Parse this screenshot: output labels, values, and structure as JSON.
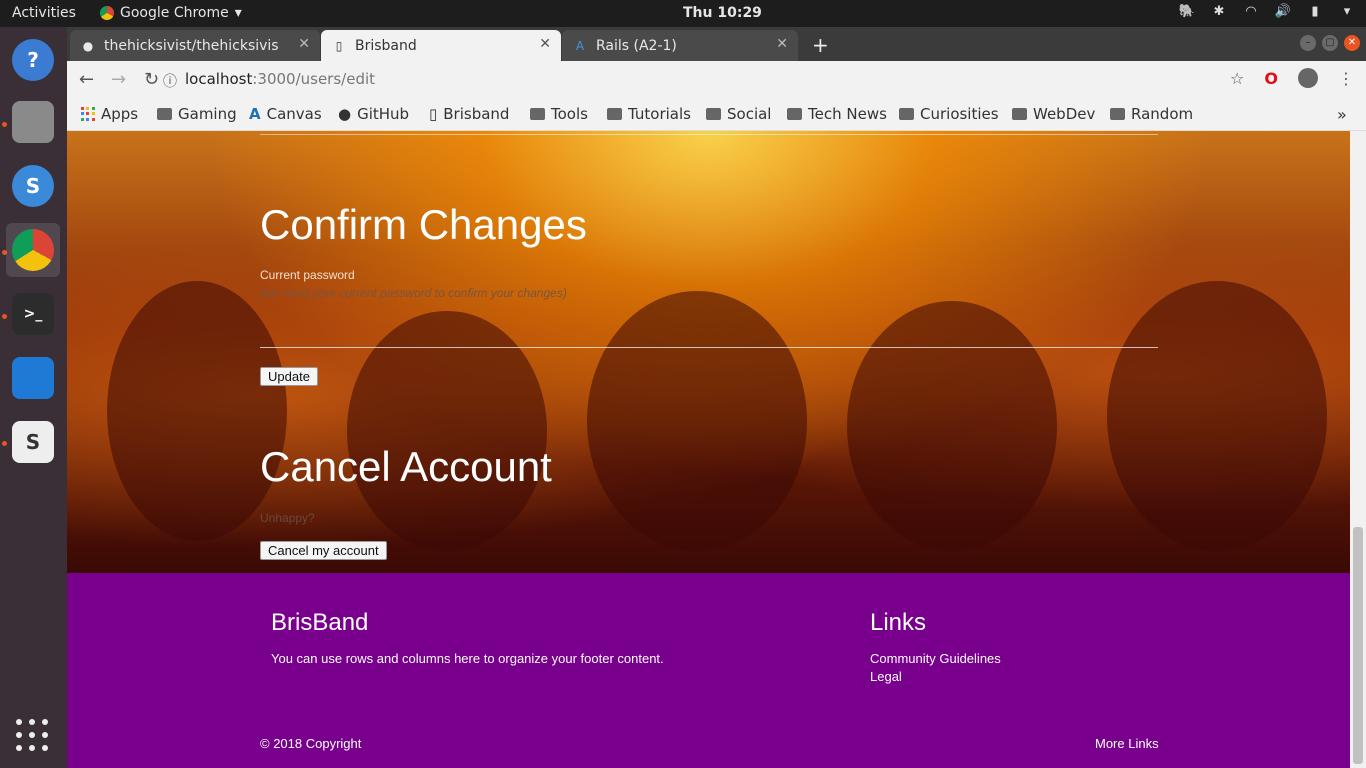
{
  "topbar": {
    "activities": "Activities",
    "app_name": "Google Chrome",
    "clock": "Thu 10:29"
  },
  "tabs": [
    {
      "label": "thehicksivist/thehicksivis",
      "icon": "github-icon"
    },
    {
      "label": "Brisband",
      "icon": "page-icon"
    },
    {
      "label": "Rails (A2-1)",
      "icon": "canvas-icon"
    }
  ],
  "omnibar": {
    "url_host": "localhost",
    "url_rest": ":3000/users/edit"
  },
  "bookmarks": [
    {
      "label": "Apps",
      "icon": "apps-icon"
    },
    {
      "label": "Gaming",
      "icon": "folder-icon"
    },
    {
      "label": "Canvas",
      "icon": "canvas-icon"
    },
    {
      "label": "GitHub",
      "icon": "github-icon"
    },
    {
      "label": "Brisband",
      "icon": "page-icon"
    },
    {
      "label": "Tools",
      "icon": "folder-icon"
    },
    {
      "label": "Tutorials",
      "icon": "folder-icon"
    },
    {
      "label": "Social",
      "icon": "folder-icon"
    },
    {
      "label": "Tech News",
      "icon": "folder-icon"
    },
    {
      "label": "Curiosities",
      "icon": "folder-icon"
    },
    {
      "label": "WebDev",
      "icon": "folder-icon"
    },
    {
      "label": "Random",
      "icon": "folder-icon"
    }
  ],
  "confirm": {
    "title": "Confirm Changes",
    "password_label": "Current password",
    "password_hint": "(we need your current password to confirm your changes)",
    "update_button": "Update"
  },
  "cancel": {
    "title": "Cancel Account",
    "text": "Unhappy?",
    "button": "Cancel my account"
  },
  "footer": {
    "brand_title": "BrisBand",
    "brand_text": "You can use rows and columns here to organize your footer content.",
    "links_title": "Links",
    "links": [
      "Community Guidelines",
      "Legal"
    ],
    "copyright": "© 2018 Copyright",
    "more_links": "More Links"
  },
  "colors": {
    "footer_bg": "#78008c",
    "ubuntu_orange": "#e95420"
  }
}
